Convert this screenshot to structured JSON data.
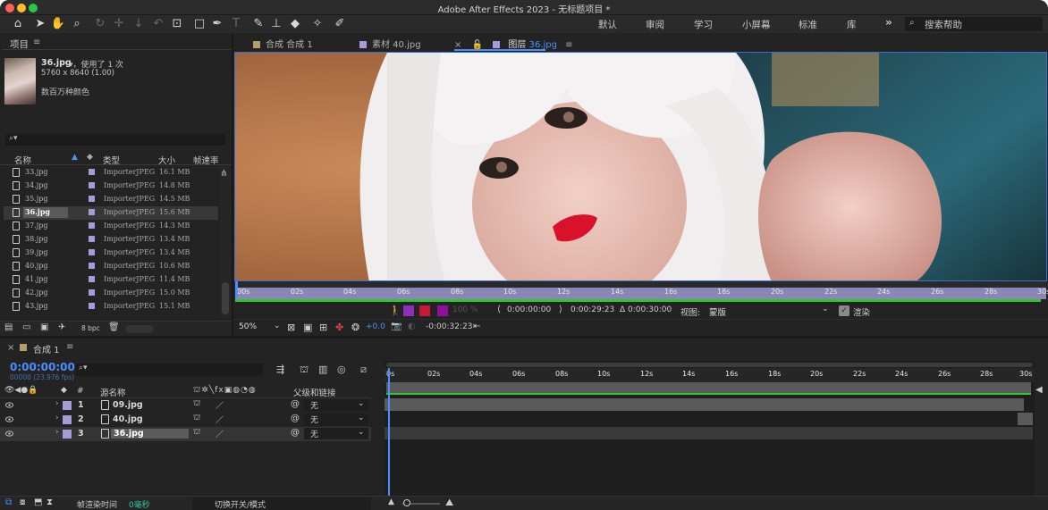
{
  "window": {
    "title": "Adobe After Effects 2023 - 无标题项目 *"
  },
  "toolbar": {
    "tools": [
      "home-icon",
      "selection-icon",
      "hand-icon",
      "zoom-icon",
      "orbit-icon",
      "pan-icon",
      "dolly-icon",
      "rotate-icon",
      "anchor-icon",
      "rectangle-icon",
      "pen-icon",
      "type-icon",
      "brush-icon",
      "clone-stamp-icon",
      "eraser-icon",
      "roto-brush-icon",
      "puppet-pin-icon"
    ],
    "workspaces": [
      "默认",
      "审阅",
      "学习",
      "小屏幕",
      "标准",
      "库"
    ],
    "more_label": "»",
    "help_placeholder": "搜索帮助"
  },
  "project": {
    "panel_title": "项目",
    "thumb_name": "36.jpg",
    "thumb_usage": "▾，使用了 1 次",
    "thumb_dims": "5760 x 8640 (1.00)",
    "thumb_colors": "数百万种颜色",
    "search_placeholder": "",
    "columns": {
      "name": "名称",
      "type": "类型",
      "size": "大小",
      "fps": "帧速率"
    },
    "rows": [
      {
        "name": "33.jpg",
        "type": "ImporterJPEG",
        "size": "16.1 MB"
      },
      {
        "name": "34.jpg",
        "type": "ImporterJPEG",
        "size": "14.8 MB"
      },
      {
        "name": "35.jpg",
        "type": "ImporterJPEG",
        "size": "14.5 MB"
      },
      {
        "name": "36.jpg",
        "type": "ImporterJPEG",
        "size": "15.6 MB",
        "selected": true
      },
      {
        "name": "37.jpg",
        "type": "ImporterJPEG",
        "size": "14.3 MB"
      },
      {
        "name": "38.jpg",
        "type": "ImporterJPEG",
        "size": "13.4 MB"
      },
      {
        "name": "39.jpg",
        "type": "ImporterJPEG",
        "size": "13.4 MB"
      },
      {
        "name": "40.jpg",
        "type": "ImporterJPEG",
        "size": "10.6 MB"
      },
      {
        "name": "41.jpg",
        "type": "ImporterJPEG",
        "size": "11.4 MB"
      },
      {
        "name": "42.jpg",
        "type": "ImporterJPEG",
        "size": "15.0 MB"
      },
      {
        "name": "43.jpg",
        "type": "ImporterJPEG",
        "size": "15.1 MB"
      }
    ],
    "bpc": "8 bpc"
  },
  "viewer": {
    "tabs": [
      {
        "label": "合成 合成 1"
      },
      {
        "label": "素材 40.jpg"
      },
      {
        "label_prefix": "图层",
        "label_file": "36.jpg"
      }
    ],
    "ruler_ticks": [
      "00s",
      "02s",
      "04s",
      "06s",
      "08s",
      "10s",
      "12s",
      "14s",
      "16s",
      "18s",
      "20s",
      "22s",
      "24s",
      "26s",
      "28s",
      "30s"
    ],
    "in_time": "0:00:00:00",
    "out_time": "0:00:29:23",
    "duration": "Δ 0:00:30:00",
    "view_label": "视图:",
    "view_value": "蒙版",
    "render_label": "渲染",
    "zoom": "50%",
    "exposure": "+0.0",
    "pct": "100 %",
    "timecode": "-0:00:32:23"
  },
  "timeline": {
    "tab_label": "合成 1",
    "timecode": "0:00:00:00",
    "frame_info": "00000 (23.976 fps)",
    "search_placeholder": "",
    "col_hash": "#",
    "col_source": "源名称",
    "col_parent": "父级和链接",
    "ruler_ticks": [
      "0s",
      "02s",
      "04s",
      "06s",
      "08s",
      "10s",
      "12s",
      "14s",
      "16s",
      "18s",
      "20s",
      "22s",
      "24s",
      "26s",
      "28s",
      "30s"
    ],
    "layers": [
      {
        "num": "1",
        "name": "09.jpg",
        "parent": "无"
      },
      {
        "num": "2",
        "name": "40.jpg",
        "parent": "无"
      },
      {
        "num": "3",
        "name": "36.jpg",
        "parent": "无",
        "selected": true
      }
    ],
    "render_time_label": "帧渲染时间",
    "render_time_value": "0毫秒",
    "toggle_label": "切换开关/模式"
  }
}
